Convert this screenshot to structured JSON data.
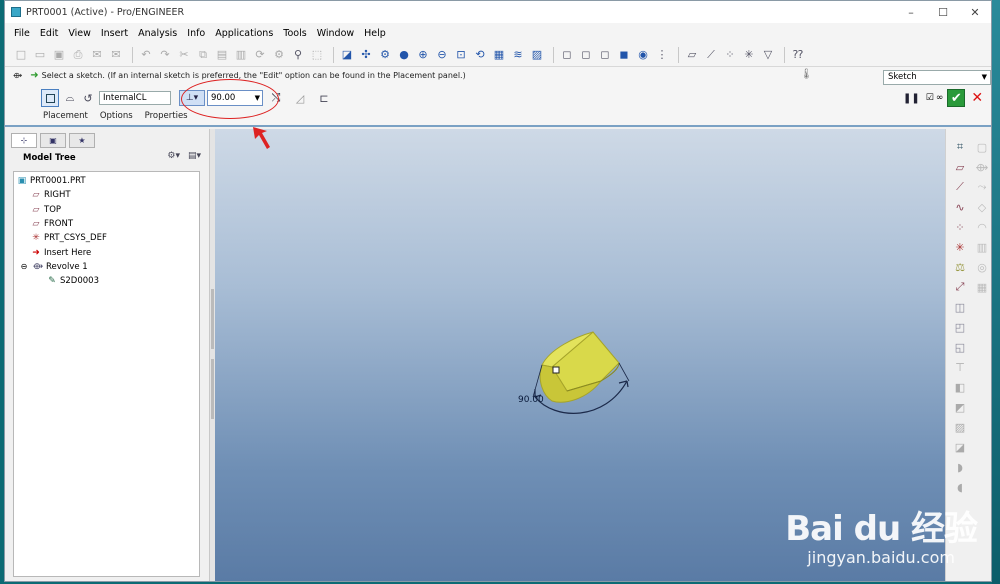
{
  "window": {
    "title": "PRT0001 (Active) - Pro/ENGINEER",
    "controls": [
      "–",
      "☐",
      "✕"
    ]
  },
  "menu": [
    "File",
    "Edit",
    "View",
    "Insert",
    "Analysis",
    "Info",
    "Applications",
    "Tools",
    "Window",
    "Help"
  ],
  "dashboard": {
    "message": "Select a sketch. (If an internal sketch is preferred, the \"Edit\" option can be found in the Placement panel.)",
    "axis_field": "InternalCL",
    "angle_value": "90.00",
    "sketch_filter": "Sketch",
    "tabs": [
      "Placement",
      "Options",
      "Properties"
    ]
  },
  "model_tree": {
    "header": "Model Tree",
    "nodes": [
      {
        "label": "PRT0001.PRT",
        "icon": "part-icon",
        "level": 0
      },
      {
        "label": "RIGHT",
        "icon": "datum-plane-icon",
        "level": 1
      },
      {
        "label": "TOP",
        "icon": "datum-plane-icon",
        "level": 1
      },
      {
        "label": "FRONT",
        "icon": "datum-plane-icon",
        "level": 1
      },
      {
        "label": "PRT_CSYS_DEF",
        "icon": "csys-icon",
        "level": 1
      },
      {
        "label": "Insert Here",
        "icon": "insert-arrow-icon",
        "level": 1
      },
      {
        "label": "Revolve 1",
        "icon": "revolve-icon",
        "level": 1
      },
      {
        "label": "S2D0003",
        "icon": "sketch-icon",
        "level": 2
      }
    ]
  },
  "viewport": {
    "dimension_label": "90.00",
    "model_color": "#d9d94a"
  },
  "annotation": {
    "color": "#dd2222"
  },
  "watermark": {
    "logo": "Bai du 经验",
    "url": "jingyan.baidu.com"
  }
}
